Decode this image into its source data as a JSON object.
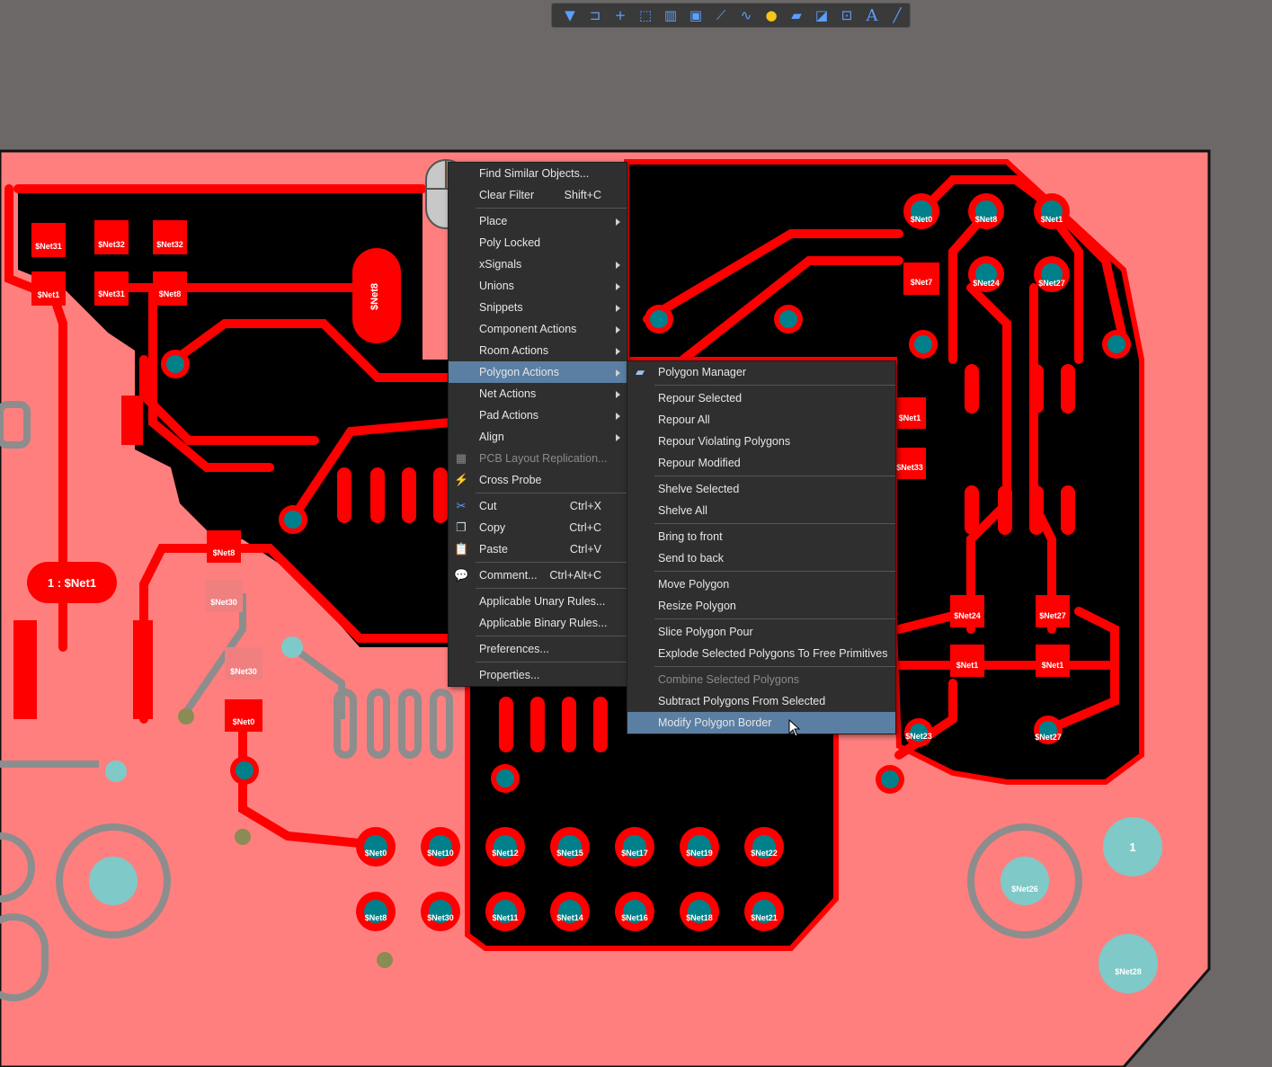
{
  "toolbar": {
    "icons": [
      "filter-icon",
      "route-icon",
      "crosshair-icon",
      "select-rect-icon",
      "bar-graph-icon",
      "component-icon",
      "track-icon",
      "interactive-route-icon",
      "hint-icon",
      "polygon-fill-icon",
      "region-icon",
      "dimension-icon",
      "text-icon",
      "line-icon"
    ]
  },
  "context_menu": {
    "items": [
      {
        "label": "Find Similar Objects...",
        "shortcut": ""
      },
      {
        "label": "Clear Filter",
        "shortcut": "Shift+C"
      },
      {
        "label": "Place",
        "submenu": true
      },
      {
        "label": "Poly Locked"
      },
      {
        "label": "xSignals",
        "submenu": true
      },
      {
        "label": "Unions",
        "submenu": true
      },
      {
        "label": "Snippets",
        "submenu": true
      },
      {
        "label": "Component Actions",
        "submenu": true
      },
      {
        "label": "Room Actions",
        "submenu": true
      },
      {
        "label": "Polygon Actions",
        "submenu": true,
        "highlighted": true
      },
      {
        "label": "Net Actions",
        "submenu": true
      },
      {
        "label": "Pad Actions",
        "submenu": true
      },
      {
        "label": "Align",
        "submenu": true
      },
      {
        "label": "PCB Layout Replication...",
        "disabled": true
      },
      {
        "label": "Cross Probe"
      },
      {
        "label": "Cut",
        "shortcut": "Ctrl+X"
      },
      {
        "label": "Copy",
        "shortcut": "Ctrl+C"
      },
      {
        "label": "Paste",
        "shortcut": "Ctrl+V"
      },
      {
        "label": "Comment...",
        "shortcut": "Ctrl+Alt+C"
      },
      {
        "label": "Applicable Unary Rules..."
      },
      {
        "label": "Applicable Binary Rules..."
      },
      {
        "label": "Preferences..."
      },
      {
        "label": "Properties..."
      }
    ]
  },
  "polygon_submenu": {
    "items": [
      {
        "label": "Polygon Manager"
      },
      {
        "label": "Repour Selected"
      },
      {
        "label": "Repour All"
      },
      {
        "label": "Repour Violating Polygons"
      },
      {
        "label": "Repour Modified"
      },
      {
        "label": "Shelve Selected"
      },
      {
        "label": "Shelve All"
      },
      {
        "label": "Bring to front"
      },
      {
        "label": "Send to back"
      },
      {
        "label": "Move Polygon"
      },
      {
        "label": "Resize Polygon"
      },
      {
        "label": "Slice Polygon Pour"
      },
      {
        "label": "Explode Selected Polygons To Free Primitives"
      },
      {
        "label": "Combine Selected Polygons",
        "disabled": true
      },
      {
        "label": "Subtract Polygons From Selected"
      },
      {
        "label": "Modify Polygon Border",
        "highlighted": true
      }
    ]
  },
  "pcb": {
    "board_color": "#ff7f7f",
    "copper_color": "#ff0000",
    "via_color": "#00808a",
    "pad_labels": {
      "big_pad": "1 : $Net1",
      "net31": "$Net31",
      "net32": "$Net32",
      "net1": "$Net1",
      "net8": "$Net8",
      "net0": "$Net0",
      "net7": "$Net7",
      "net30": "$Net30",
      "net10": "$Net10",
      "net12": "$Net12",
      "net15": "$Net15",
      "net17": "$Net17",
      "net19": "$Net19",
      "net22": "$Net22",
      "net11": "$Net11",
      "net14": "$Net14",
      "net16": "$Net16",
      "net18": "$Net18",
      "net21": "$Net21",
      "net24": "$Net24",
      "net27": "$Net27",
      "net33": "$Net33",
      "net23": "$Net23",
      "net26": "$Net26",
      "net28": "$Net28",
      "one": "1"
    }
  }
}
